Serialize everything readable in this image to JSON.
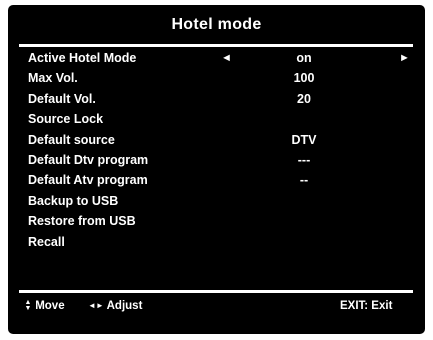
{
  "title": "Hotel mode",
  "menu": {
    "items": [
      {
        "label": "Active Hotel Mode",
        "value": "on",
        "left_arrow": "◄",
        "right_arrow": "►"
      },
      {
        "label": "Max Vol.",
        "value": "100"
      },
      {
        "label": "Default Vol.",
        "value": "20"
      },
      {
        "label": "Source Lock",
        "value": ""
      },
      {
        "label": "Default source",
        "value": "DTV"
      },
      {
        "label": "Default Dtv  program",
        "value": "---"
      },
      {
        "label": "Default Atv  program",
        "value": "--"
      },
      {
        "label": "Backup to USB",
        "value": ""
      },
      {
        "label": "Restore from USB",
        "value": ""
      },
      {
        "label": "Recall",
        "value": ""
      }
    ]
  },
  "footer": {
    "move_icon_up": "▲",
    "move_icon_down": "▼",
    "move_label": "Move",
    "adjust_icon": "◄►",
    "adjust_label": "Adjust",
    "exit_label": "EXIT: Exit"
  },
  "colors": {
    "background": "#000000",
    "text": "#ffffff"
  }
}
